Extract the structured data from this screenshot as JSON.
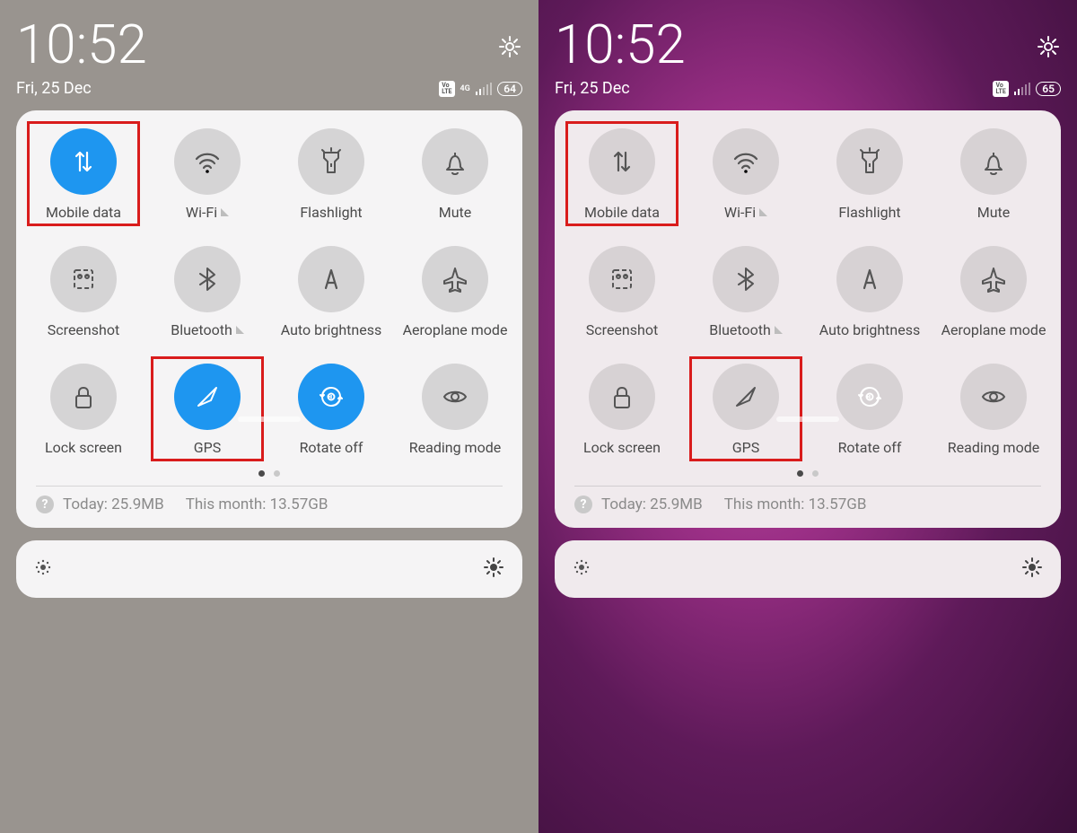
{
  "panels": [
    {
      "side": "left",
      "time": "10:52",
      "date": "Fri, 25 Dec",
      "battery": "64",
      "signal_4g": true,
      "tiles": [
        {
          "id": "mobile-data",
          "label": "Mobile data",
          "icon": "data",
          "active": true,
          "sub": false,
          "hl": true
        },
        {
          "id": "wifi",
          "label": "Wi-Fi",
          "icon": "wifi",
          "active": false,
          "sub": true,
          "hl": false
        },
        {
          "id": "flashlight",
          "label": "Flashlight",
          "icon": "flashlight",
          "active": false,
          "sub": false,
          "hl": false
        },
        {
          "id": "mute",
          "label": "Mute",
          "icon": "bell",
          "active": false,
          "sub": false,
          "hl": false
        },
        {
          "id": "screenshot",
          "label": "Screenshot",
          "icon": "screenshot",
          "active": false,
          "sub": false,
          "hl": false
        },
        {
          "id": "bluetooth",
          "label": "Bluetooth",
          "icon": "bluetooth",
          "active": false,
          "sub": true,
          "hl": false
        },
        {
          "id": "auto-brightness",
          "label": "Auto brightness",
          "icon": "autobright",
          "active": false,
          "sub": false,
          "hl": false
        },
        {
          "id": "aeroplane",
          "label": "Aeroplane mode",
          "icon": "plane",
          "active": false,
          "sub": false,
          "hl": false
        },
        {
          "id": "lock-screen",
          "label": "Lock screen",
          "icon": "lock",
          "active": false,
          "sub": false,
          "hl": false
        },
        {
          "id": "gps",
          "label": "GPS",
          "icon": "gps",
          "active": true,
          "sub": false,
          "hl": true
        },
        {
          "id": "rotate",
          "label": "Rotate off",
          "icon": "rotate",
          "active": true,
          "sub": false,
          "hl": false
        },
        {
          "id": "reading",
          "label": "Reading mode",
          "icon": "eye",
          "active": false,
          "sub": false,
          "hl": false
        }
      ],
      "usage_today": "Today: 25.9MB",
      "usage_month": "This month: 13.57GB"
    },
    {
      "side": "right",
      "time": "10:52",
      "date": "Fri, 25 Dec",
      "battery": "65",
      "signal_4g": false,
      "tiles": [
        {
          "id": "mobile-data",
          "label": "Mobile data",
          "icon": "data",
          "active": false,
          "sub": false,
          "hl": true
        },
        {
          "id": "wifi",
          "label": "Wi-Fi",
          "icon": "wifi",
          "active": false,
          "sub": true,
          "hl": false
        },
        {
          "id": "flashlight",
          "label": "Flashlight",
          "icon": "flashlight",
          "active": false,
          "sub": false,
          "hl": false
        },
        {
          "id": "mute",
          "label": "Mute",
          "icon": "bell",
          "active": false,
          "sub": false,
          "hl": false
        },
        {
          "id": "screenshot",
          "label": "Screenshot",
          "icon": "screenshot",
          "active": false,
          "sub": false,
          "hl": false
        },
        {
          "id": "bluetooth",
          "label": "Bluetooth",
          "icon": "bluetooth",
          "active": false,
          "sub": true,
          "hl": false
        },
        {
          "id": "auto-brightness",
          "label": "Auto brightness",
          "icon": "autobright",
          "active": false,
          "sub": false,
          "hl": false
        },
        {
          "id": "aeroplane",
          "label": "Aeroplane mode",
          "icon": "plane",
          "active": false,
          "sub": false,
          "hl": false
        },
        {
          "id": "lock-screen",
          "label": "Lock screen",
          "icon": "lock",
          "active": false,
          "sub": false,
          "hl": false
        },
        {
          "id": "gps",
          "label": "GPS",
          "icon": "gps",
          "active": false,
          "sub": false,
          "hl": true
        },
        {
          "id": "rotate",
          "label": "Rotate off",
          "icon": "rotate",
          "active": true,
          "sub": false,
          "hl": false
        },
        {
          "id": "reading",
          "label": "Reading mode",
          "icon": "eye",
          "active": false,
          "sub": false,
          "hl": false
        }
      ],
      "usage_today": "Today: 25.9MB",
      "usage_month": "This month: 13.57GB"
    }
  ]
}
